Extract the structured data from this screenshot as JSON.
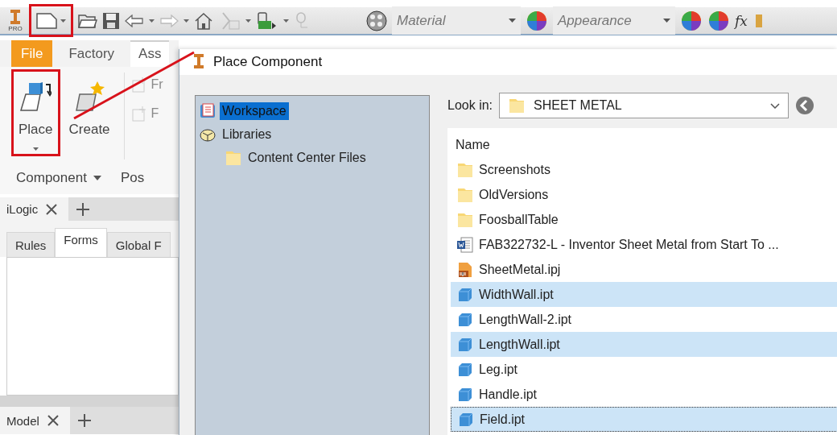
{
  "toolbar": {
    "logo_text": "PRO",
    "new_button": {
      "highlighted": true
    },
    "material": {
      "placeholder": "Material"
    },
    "appearance": {
      "placeholder": "Appearance"
    },
    "formula_button": {
      "label": "fx"
    }
  },
  "ribbon": {
    "tabs": [
      {
        "label": "File",
        "kind": "application",
        "selected": false
      },
      {
        "label": "Factory",
        "kind": "tab",
        "selected": false
      },
      {
        "label": "Ass",
        "kind": "tab",
        "selected": true
      }
    ],
    "buttons": [
      {
        "label": "Place",
        "highlighted": true,
        "dropdown": true
      },
      {
        "label": "Create",
        "highlighted": false,
        "dropdown": false
      }
    ],
    "small_items": [
      {
        "label": "Fr",
        "disabled": true
      },
      {
        "label": "F",
        "disabled": true
      }
    ],
    "groups": [
      {
        "label": "Component",
        "dropdown": true
      },
      {
        "label": "Pos",
        "dropdown": false
      }
    ]
  },
  "ilogic_panel": {
    "title": "iLogic",
    "tabs": [
      {
        "label": "Rules",
        "selected": false
      },
      {
        "label": "Forms",
        "selected": true
      },
      {
        "label": "Global F",
        "selected": false
      }
    ]
  },
  "model_panel": {
    "title": "Model"
  },
  "callout_line": true,
  "dialog": {
    "title": "Place Component",
    "tree": [
      {
        "label": "Workspace",
        "kind": "workspace",
        "selected": true
      },
      {
        "label": "Libraries",
        "kind": "libraries",
        "selected": false,
        "children": [
          {
            "label": "Content Center Files",
            "kind": "folder",
            "selected": false
          }
        ]
      }
    ],
    "look_in": {
      "label": "Look in:",
      "value": "SHEET METAL"
    },
    "file_list": {
      "columns": [
        "Name"
      ],
      "rows": [
        {
          "name": "Screenshots",
          "kind": "folder",
          "selected": false,
          "focused": false
        },
        {
          "name": "OldVersions",
          "kind": "folder",
          "selected": false,
          "focused": false
        },
        {
          "name": "FoosballTable",
          "kind": "folder",
          "selected": false,
          "focused": false
        },
        {
          "name": "FAB322732-L - Inventor Sheet Metal from Start To ...",
          "kind": "document",
          "selected": false,
          "focused": false
        },
        {
          "name": "SheetMetal.ipj",
          "kind": "project",
          "selected": false,
          "focused": false
        },
        {
          "name": "WidthWall.ipt",
          "kind": "part",
          "selected": true,
          "focused": false
        },
        {
          "name": "LengthWall-2.ipt",
          "kind": "part",
          "selected": false,
          "focused": false
        },
        {
          "name": "LengthWall.ipt",
          "kind": "part",
          "selected": true,
          "focused": false
        },
        {
          "name": "Leg.ipt",
          "kind": "part",
          "selected": false,
          "focused": false
        },
        {
          "name": "Handle.ipt",
          "kind": "part",
          "selected": false,
          "focused": false
        },
        {
          "name": "Field.ipt",
          "kind": "part",
          "selected": true,
          "focused": true
        }
      ]
    }
  }
}
